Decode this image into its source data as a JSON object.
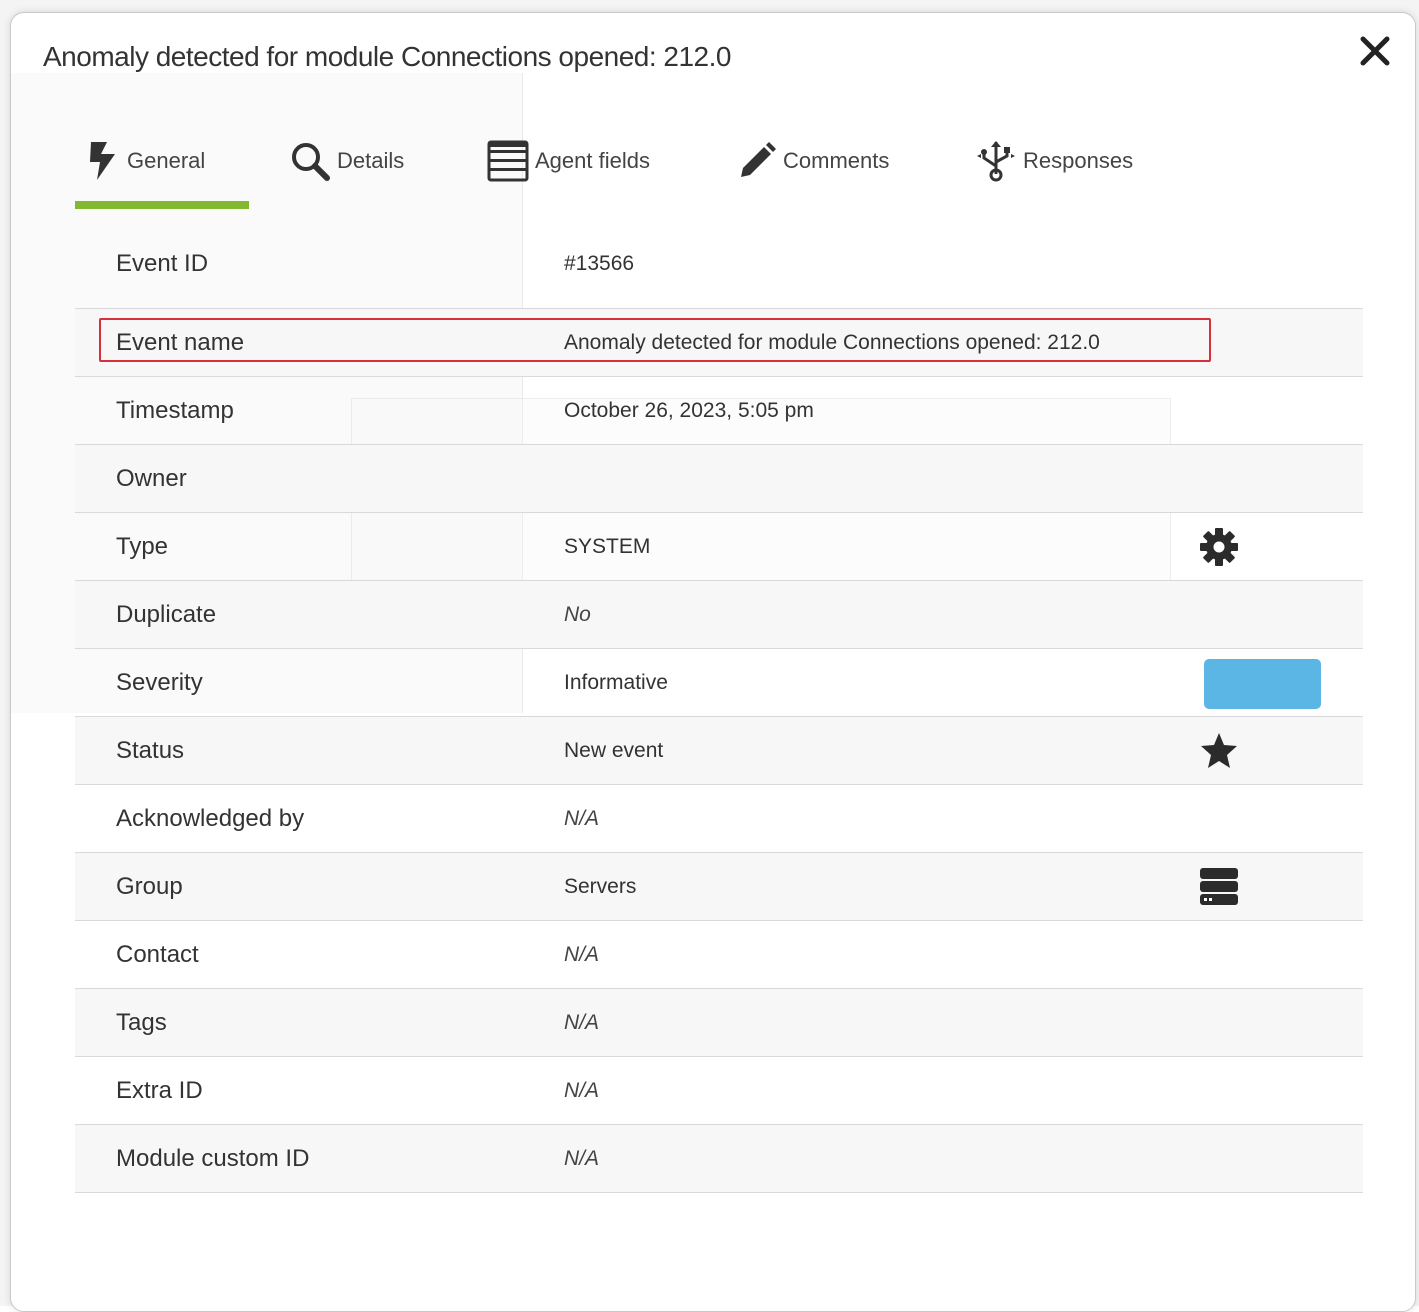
{
  "modal": {
    "title": "Anomaly detected for module Connections opened: 212.0",
    "close_glyph": "✕"
  },
  "tabs": [
    {
      "label": "General",
      "icon": "lightning-icon",
      "active": true
    },
    {
      "label": "Details",
      "icon": "magnifier-icon",
      "active": false
    },
    {
      "label": "Agent fields",
      "icon": "list-icon",
      "active": false
    },
    {
      "label": "Comments",
      "icon": "pencil-icon",
      "active": false
    },
    {
      "label": "Responses",
      "icon": "usb-icon",
      "active": false
    }
  ],
  "colors": {
    "active_tab_underline": "#82b92e",
    "severity_informative": "#5bb6e5",
    "highlight_border": "#d7303a"
  },
  "rows": [
    {
      "label": "Event ID",
      "value": "#13566"
    },
    {
      "label": "Event name",
      "value": "Anomaly detected for module Connections opened: 212.0",
      "highlighted": true
    },
    {
      "label": "Timestamp",
      "value": "October 26, 2023, 5:05 pm"
    },
    {
      "label": "Owner",
      "value": ""
    },
    {
      "label": "Type",
      "value": "SYSTEM",
      "icon": "gear-icon"
    },
    {
      "label": "Duplicate",
      "value": "No"
    },
    {
      "label": "Severity",
      "value": "Informative",
      "swatch": "severity-color"
    },
    {
      "label": "Status",
      "value": "New event",
      "icon": "star-icon"
    },
    {
      "label": "Acknowledged by",
      "value": "N/A"
    },
    {
      "label": "Group",
      "value": "Servers",
      "icon": "server-icon"
    },
    {
      "label": "Contact",
      "value": "N/A"
    },
    {
      "label": "Tags",
      "value": "N/A"
    },
    {
      "label": "Extra ID",
      "value": "N/A"
    },
    {
      "label": "Module custom ID",
      "value": "N/A"
    }
  ]
}
